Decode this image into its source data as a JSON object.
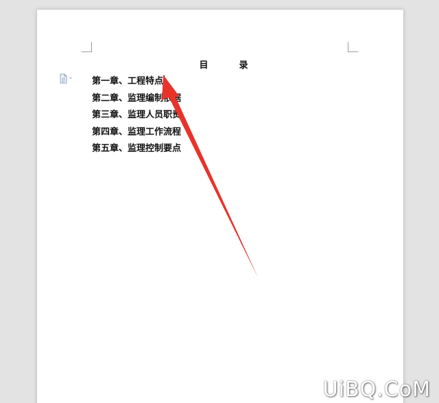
{
  "document": {
    "toc_title": "目　录",
    "toc_items": [
      {
        "label": "第一章、工程特点"
      },
      {
        "label": "第二章、监理编制依据"
      },
      {
        "label": "第三章、监理人员职责"
      },
      {
        "label": "第四章、监理工作流程"
      },
      {
        "label": "第五章、监理控制要点"
      }
    ]
  },
  "paste_options": {
    "icon": "paste-options-icon"
  },
  "annotation": {
    "arrow_color": "#e8332a",
    "icon": "red-arrow-annotation"
  },
  "watermark": {
    "text": "UiBQ.CoM"
  },
  "colors": {
    "workspace": "#e3e3e3",
    "page": "#ffffff",
    "text": "#111111"
  }
}
